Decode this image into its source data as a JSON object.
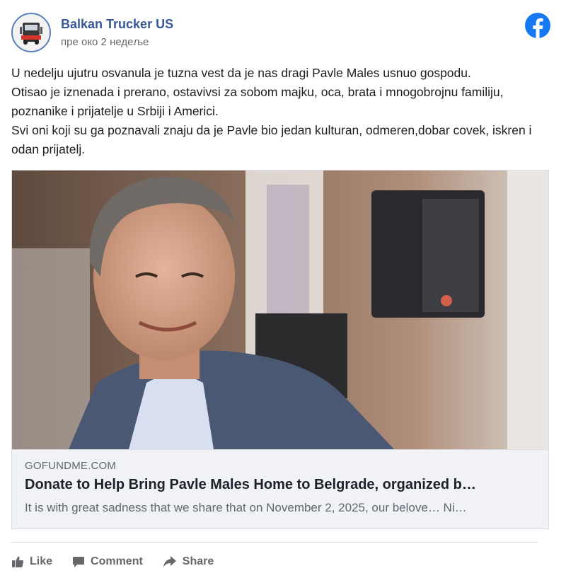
{
  "post": {
    "page_name": "Balkan Trucker US",
    "timestamp": "пре око 2 недеље",
    "text": "U nedelju ujutru osvanula je tuzna vest da je nas dragi Pavle Males usnuo gospodu.\nOtisao je iznenada i prerano, ostavivsi za sobom majku, oca, brata i mnogobrojnu familiju, poznanike i prijatelje u Srbiji i Americi.\nSvi oni koji su ga poznavali znaju da je Pavle bio jedan kulturan, odmeren,dobar covek, iskren i odan prijatelj."
  },
  "link": {
    "domain": "GOFUNDME.COM",
    "title": "Donate to Help Bring Pavle Males Home to Belgrade, organized b…",
    "description": "It is with great sadness that we share that on November 2, 2025, our belove… Ni…"
  },
  "actions": {
    "like": "Like",
    "comment": "Comment",
    "share": "Share"
  },
  "icons": {
    "avatar": "truck-logo-icon",
    "platform": "facebook-icon",
    "like": "thumbs-up-icon",
    "comment": "speech-bubble-icon",
    "share": "share-arrow-icon"
  },
  "colors": {
    "page_name": "#385898",
    "facebook_blue": "#1877f2",
    "muted_text": "#65676b",
    "link_bg": "#f0f2f5"
  }
}
